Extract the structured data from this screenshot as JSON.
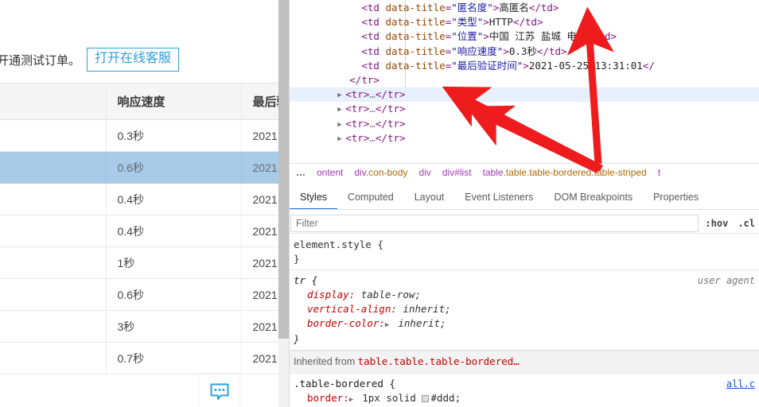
{
  "page": {
    "notice_text": "开通测试订单。",
    "kefu_button_label": "打开在线客服",
    "table": {
      "headers": [
        "",
        "响应速度",
        "最后验"
      ],
      "rows": [
        {
          "c0": "",
          "c1": "0.3秒",
          "c2": "2021",
          "selected": false
        },
        {
          "c0": "",
          "c1": "0.6秒",
          "c2": "2021",
          "selected": true
        },
        {
          "c0": "",
          "c1": "0.4秒",
          "c2": "2021",
          "selected": false
        },
        {
          "c0": "",
          "c1": "0.4秒",
          "c2": "2021",
          "selected": false
        },
        {
          "c0": "",
          "c1": "1秒",
          "c2": "2021",
          "selected": false
        },
        {
          "c0": "",
          "c1": "0.6秒",
          "c2": "2021",
          "selected": false
        },
        {
          "c0": "",
          "c1": "3秒",
          "c2": "2021",
          "selected": false
        },
        {
          "c0": "",
          "c1": "0.7秒",
          "c2": "2021",
          "selected": false
        }
      ]
    },
    "chat_widget_icon": "chat-bubble-icon"
  },
  "devtools": {
    "dom_rows": [
      {
        "type": "td",
        "attr": "data-title",
        "value": "匿名度",
        "text": "高匿名"
      },
      {
        "type": "td",
        "attr": "data-title",
        "value": "类型",
        "text": "HTTP"
      },
      {
        "type": "td",
        "attr": "data-title",
        "value": "位置",
        "text": "中国  江苏  盐城  电信"
      },
      {
        "type": "td",
        "attr": "data-title",
        "value": "响应速度",
        "text": "0.3秒"
      },
      {
        "type": "td",
        "attr": "data-title",
        "value": "最后验证时间",
        "text": "2021-05-25 13:31:01",
        "truncated": true
      },
      {
        "type": "close-tr",
        "text": "</tr>"
      },
      {
        "type": "tr-collapsed",
        "text": "<tr>…</tr>",
        "selected": true
      },
      {
        "type": "tr-collapsed",
        "text": "<tr>…</tr>",
        "selected": false
      },
      {
        "type": "tr-collapsed",
        "text": "<tr>…</tr>",
        "selected": false
      },
      {
        "type": "tr-collapsed",
        "text": "<tr>…</tr>",
        "selected": false
      }
    ],
    "breadcrumb": [
      {
        "label": "…",
        "kind": "dots"
      },
      {
        "label": "ontent",
        "kind": "plain"
      },
      {
        "label": "div.con-body",
        "kind": "plain"
      },
      {
        "label": "div",
        "kind": "plain"
      },
      {
        "label": "div#list",
        "kind": "plain"
      },
      {
        "label": "table.table.table-bordered.table-striped",
        "kind": "plain"
      },
      {
        "label": "t",
        "kind": "plain"
      }
    ],
    "tabs": [
      {
        "label": "Styles",
        "active": true
      },
      {
        "label": "Computed",
        "active": false
      },
      {
        "label": "Layout",
        "active": false
      },
      {
        "label": "Event Listeners",
        "active": false
      },
      {
        "label": "DOM Breakpoints",
        "active": false
      },
      {
        "label": "Properties",
        "active": false
      }
    ],
    "filter": {
      "placeholder": "Filter",
      "value": ""
    },
    "pseudo_buttons": [
      ":hov",
      ".cl"
    ],
    "styles": {
      "element_style": {
        "selector": "element.style {",
        "close": "}"
      },
      "tr_rule": {
        "selector": "tr {",
        "origin": "user agent",
        "declarations": [
          {
            "prop": "display:",
            "value": "table-row;",
            "expandable": false
          },
          {
            "prop": "vertical-align:",
            "value": "inherit;",
            "expandable": false
          },
          {
            "prop": "border-color:",
            "value": "inherit;",
            "expandable": true
          }
        ],
        "close": "}"
      },
      "inherited_from": {
        "prefix": "Inherited from",
        "selector": "table.table.table-bordered…"
      },
      "table_bordered_rule": {
        "selector": ".table-bordered {",
        "origin": "all.c",
        "declarations": [
          {
            "prop": "border:",
            "value": "1px solid",
            "swatch": "#ddd",
            "suffix": "#ddd;",
            "expandable": true
          }
        ]
      }
    }
  },
  "colors": {
    "accent_blue": "#1a73e8",
    "selected_row_page": "#a8cbe8",
    "selected_row_dom": "#e8f0fe",
    "annotation_red": "#ee1c1c",
    "button_border": "#2f9fd8"
  }
}
